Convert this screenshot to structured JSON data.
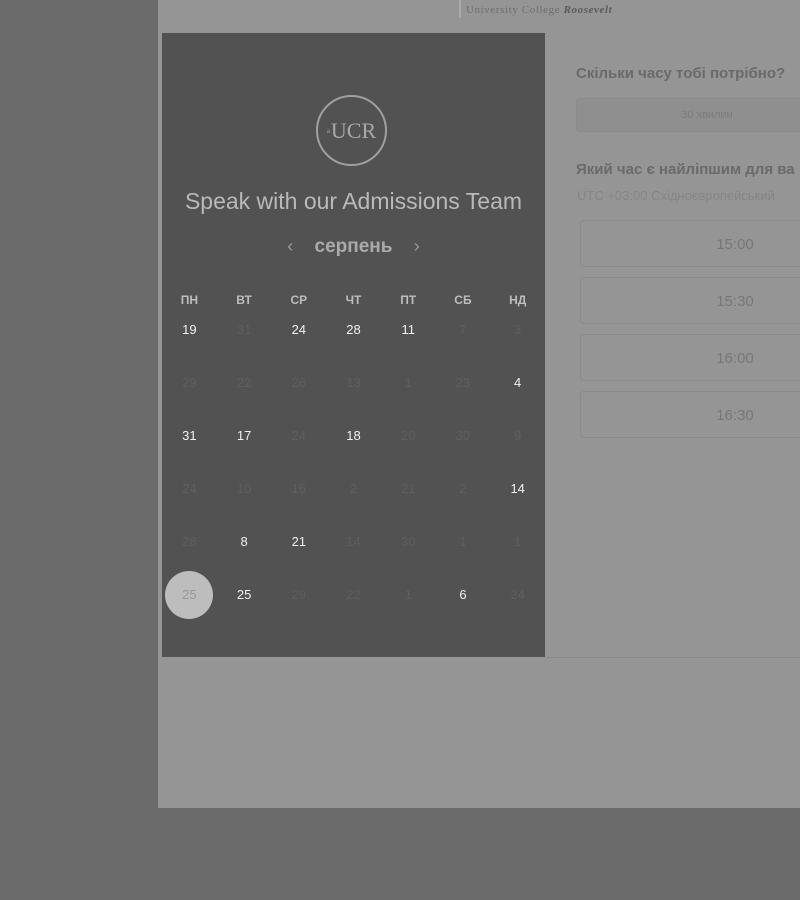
{
  "brand": {
    "name": "University College",
    "name_bold": "Roosevelt"
  },
  "logo": {
    "small": "a",
    "text": "UCR"
  },
  "panel": {
    "title": "Speak with our Admissions Team",
    "month": "серпень",
    "prev_icon": "chevron-left",
    "next_icon": "chevron-right",
    "weekdays": [
      "ПН",
      "ВТ",
      "СР",
      "ЧТ",
      "ПТ",
      "СБ",
      "НД"
    ],
    "weeks": [
      [
        {
          "d": "19",
          "a": true
        },
        {
          "d": "31",
          "a": false
        },
        {
          "d": "24",
          "a": true
        },
        {
          "d": "28",
          "a": true
        },
        {
          "d": "11",
          "a": true
        },
        {
          "d": "7",
          "a": false
        },
        {
          "d": "3",
          "a": false
        }
      ],
      [
        {
          "d": "29",
          "a": false
        },
        {
          "d": "22",
          "a": false
        },
        {
          "d": "26",
          "a": false
        },
        {
          "d": "13",
          "a": false
        },
        {
          "d": "1",
          "a": false
        },
        {
          "d": "23",
          "a": false
        },
        {
          "d": "4",
          "a": true
        }
      ],
      [
        {
          "d": "31",
          "a": true
        },
        {
          "d": "17",
          "a": true
        },
        {
          "d": "24",
          "a": false
        },
        {
          "d": "18",
          "a": true
        },
        {
          "d": "20",
          "a": false
        },
        {
          "d": "30",
          "a": false
        },
        {
          "d": "9",
          "a": false
        }
      ],
      [
        {
          "d": "24",
          "a": false
        },
        {
          "d": "10",
          "a": false
        },
        {
          "d": "16",
          "a": false
        },
        {
          "d": "2",
          "a": false
        },
        {
          "d": "21",
          "a": false
        },
        {
          "d": "2",
          "a": false
        },
        {
          "d": "14",
          "a": true
        }
      ],
      [
        {
          "d": "28",
          "a": false
        },
        {
          "d": "8",
          "a": true
        },
        {
          "d": "21",
          "a": true
        },
        {
          "d": "14",
          "a": false
        },
        {
          "d": "30",
          "a": false
        },
        {
          "d": "1",
          "a": false
        },
        {
          "d": "1",
          "a": false
        }
      ],
      [
        {
          "d": "25",
          "a": true,
          "sel": true
        },
        {
          "d": "25",
          "a": true
        },
        {
          "d": "29",
          "a": false
        },
        {
          "d": "22",
          "a": false
        },
        {
          "d": "1",
          "a": false
        },
        {
          "d": "6",
          "a": true
        },
        {
          "d": "24",
          "a": false
        }
      ]
    ]
  },
  "booking": {
    "duration_question": "Скільки часу тобі потрібно?",
    "duration_value": "30 хвилин",
    "time_question": "Який час є найліпшим для ва",
    "timezone": "UTC +03:00 Східноєвропейський",
    "slots": [
      "15:00",
      "15:30",
      "16:00",
      "16:30"
    ]
  }
}
